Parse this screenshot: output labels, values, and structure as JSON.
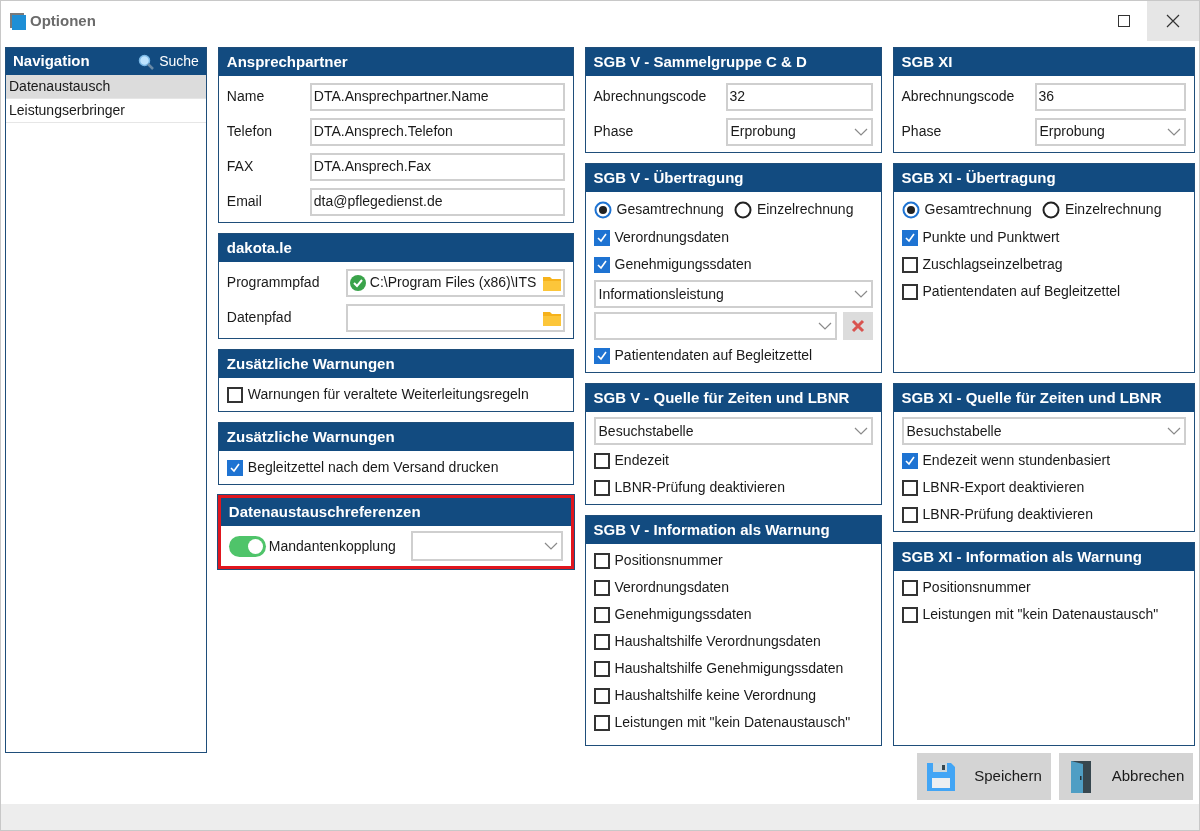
{
  "window": {
    "title": "Optionen"
  },
  "navigation": {
    "title": "Navigation",
    "search": "Suche",
    "items": [
      {
        "label": "Datenaustausch",
        "selected": true
      },
      {
        "label": "Leistungserbringer",
        "selected": false
      }
    ]
  },
  "columns": [
    [
      {
        "title": "Ansprechpartner",
        "highlighted": false,
        "items": [
          {
            "kind": "text_field",
            "label": "Name",
            "value": "DTA.Ansprechpartner.Name"
          },
          {
            "kind": "text_field",
            "label": "Telefon",
            "value": "DTA.Ansprech.Telefon"
          },
          {
            "kind": "text_field",
            "label": "FAX",
            "value": "DTA.Ansprech.Fax"
          },
          {
            "kind": "text_field",
            "label": "Email",
            "value": "dta@pflegedienst.de"
          }
        ]
      },
      {
        "title": "dakota.le",
        "highlighted": false,
        "items": [
          {
            "kind": "path_field",
            "label": "Programmpfad",
            "value": "C:\\Program Files (x86)\\ITS",
            "valid": true
          },
          {
            "kind": "path_field",
            "label": "Datenpfad",
            "valid": false
          }
        ]
      },
      {
        "title": "Zusätzliche Warnungen",
        "highlighted": false,
        "items": [
          {
            "kind": "checkbox",
            "label": "Warnungen für veraltete Weiterleitungsregeln",
            "checked": false
          }
        ]
      },
      {
        "title": "Zusätzliche Warnungen",
        "highlighted": false,
        "items": [
          {
            "kind": "checkbox",
            "label": "Begleitzettel nach dem Versand drucken",
            "checked": true
          }
        ]
      },
      {
        "title": "Datenaustauschreferenzen",
        "highlighted": true,
        "items": [
          {
            "kind": "toggle_select",
            "label": "Mandantenkopplung",
            "on": true
          }
        ]
      }
    ],
    [
      {
        "title": "SGB V - Sammelgruppe C & D",
        "highlighted": false,
        "items": [
          {
            "kind": "text_field",
            "label": "Abrechnungscode",
            "value": "32"
          },
          {
            "kind": "select",
            "label": "Phase",
            "value": "Erprobung"
          }
        ]
      },
      {
        "title": "SGB V - Übertragung",
        "highlighted": false,
        "items": [
          {
            "kind": "radio_group",
            "options": [
              {
                "label": "Gesamtrechnung",
                "selected": true
              },
              {
                "label": "Einzelrechnung",
                "selected": false
              }
            ]
          },
          {
            "kind": "checkbox",
            "label": "Verordnungsdaten",
            "checked": true
          },
          {
            "kind": "checkbox",
            "label": "Genehmigungssdaten",
            "checked": true
          },
          {
            "kind": "dropdown",
            "value": "Informationsleistung"
          },
          {
            "kind": "dropdown_clear"
          },
          {
            "kind": "checkbox",
            "label": "Patientendaten auf Begleitzettel",
            "checked": true
          }
        ]
      },
      {
        "title": "SGB V - Quelle für Zeiten und LBNR",
        "highlighted": false,
        "items": [
          {
            "kind": "dropdown",
            "value": "Besuchstabelle"
          },
          {
            "kind": "checkbox",
            "label": "Endezeit",
            "checked": false
          },
          {
            "kind": "checkbox",
            "label": "LBNR-Prüfung deaktivieren",
            "checked": false
          }
        ]
      },
      {
        "title": "SGB V - Information als Warnung",
        "highlighted": false,
        "items": [
          {
            "kind": "checkbox",
            "label": "Positionsnummer",
            "checked": false
          },
          {
            "kind": "checkbox",
            "label": "Verordnungsdaten",
            "checked": false
          },
          {
            "kind": "checkbox",
            "label": "Genehmigungssdaten",
            "checked": false
          },
          {
            "kind": "checkbox",
            "label": "Haushaltshilfe Verordnungsdaten",
            "checked": false
          },
          {
            "kind": "checkbox",
            "label": "Haushaltshilfe Genehmigungssdaten",
            "checked": false
          },
          {
            "kind": "checkbox",
            "label": "Haushaltshilfe keine Verordnung",
            "checked": false
          },
          {
            "kind": "checkbox",
            "label": "Leistungen mit \"kein Datenaustausch\"",
            "checked": false
          }
        ]
      }
    ],
    [
      {
        "title": "SGB XI",
        "highlighted": false,
        "items": [
          {
            "kind": "text_field",
            "label": "Abrechnungscode",
            "value": "36"
          },
          {
            "kind": "select",
            "label": "Phase",
            "value": "Erprobung"
          }
        ]
      },
      {
        "title": "SGB XI - Übertragung",
        "highlighted": false,
        "items": [
          {
            "kind": "radio_group",
            "options": [
              {
                "label": "Gesamtrechnung",
                "selected": true
              },
              {
                "label": "Einzelrechnung",
                "selected": false
              }
            ]
          },
          {
            "kind": "checkbox",
            "label": "Punkte und Punktwert",
            "checked": true
          },
          {
            "kind": "checkbox",
            "label": "Zuschlagseinzelbetrag",
            "checked": false
          },
          {
            "kind": "checkbox",
            "label": "Patientendaten auf Begleitzettel",
            "checked": false
          }
        ]
      },
      {
        "title": "SGB XI - Quelle für Zeiten und LBNR",
        "highlighted": false,
        "items": [
          {
            "kind": "dropdown",
            "value": "Besuchstabelle"
          },
          {
            "kind": "checkbox",
            "label": "Endezeit wenn stundenbasiert",
            "checked": true
          },
          {
            "kind": "checkbox",
            "label": "LBNR-Export deaktivieren",
            "checked": false
          },
          {
            "kind": "checkbox",
            "label": "LBNR-Prüfung deaktivieren",
            "checked": false
          }
        ]
      },
      {
        "title": "SGB XI - Information als Warnung",
        "highlighted": false,
        "items": [
          {
            "kind": "checkbox",
            "label": "Positionsnummer",
            "checked": false
          },
          {
            "kind": "checkbox",
            "label": "Leistungen mit \"kein Datenaustausch\"",
            "checked": false
          }
        ]
      }
    ]
  ],
  "buttons": [
    {
      "kind": "save",
      "label": "Speichern"
    },
    {
      "kind": "cancel",
      "label": "Abbrechen"
    }
  ]
}
